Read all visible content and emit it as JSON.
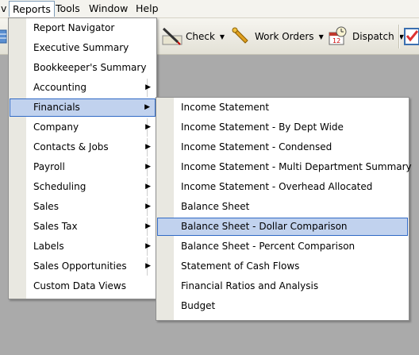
{
  "menubar": {
    "items": [
      {
        "label": "v"
      },
      {
        "label": "Reports"
      },
      {
        "label": "Tools"
      },
      {
        "label": "Window"
      },
      {
        "label": "Help"
      }
    ]
  },
  "toolbar": {
    "check": "Check",
    "work_orders": "Work Orders",
    "dispatch": "Dispatch"
  },
  "reports_menu": [
    "Report Navigator",
    "Executive Summary",
    "Bookkeeper's Summary",
    "Accounting",
    "Financials",
    "Company",
    "Contacts & Jobs",
    "Payroll",
    "Scheduling",
    "Sales",
    "Sales Tax",
    "Labels",
    "Sales Opportunities",
    "Custom Data Views"
  ],
  "financials_menu": [
    "Income Statement",
    "Income Statement - By Dept Wide",
    "Income Statement - Condensed",
    "Income Statement - Multi Department Summary",
    "Income Statement - Overhead Allocated",
    "Balance Sheet",
    "Balance Sheet - Dollar Comparison",
    "Balance Sheet - Percent Comparison",
    "Statement of Cash Flows",
    "Financial Ratios and Analysis",
    "Budget"
  ],
  "colors": {
    "highlight": "#c1d2ee",
    "highlight_border": "#316ac5"
  }
}
